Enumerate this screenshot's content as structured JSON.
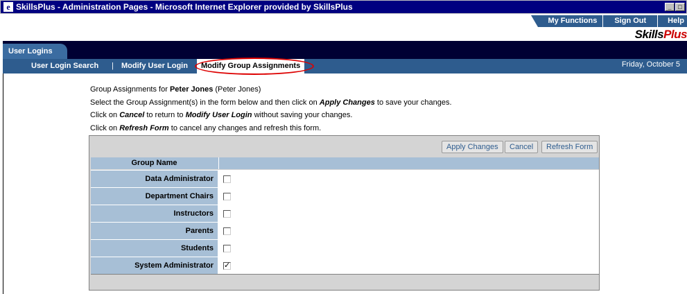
{
  "window": {
    "title": "SkillsPlus - Administration Pages - Microsoft Internet Explorer provided by SkillsPlus",
    "icon": "ie-icon",
    "min_label": "_",
    "max_label": "□"
  },
  "topnav": {
    "items": [
      "My Functions",
      "Sign Out",
      "Help"
    ]
  },
  "brand": {
    "name": "Skills",
    "suffix": "Plus"
  },
  "section_tab": "User Logins",
  "subnav": {
    "items": [
      "User Login Search",
      "Modify User Login",
      "Modify Group Assignments"
    ],
    "separator": "|",
    "active_index": 2,
    "date": "Friday, October 5"
  },
  "instructions": {
    "line1_prefix": "Group Assignments for ",
    "user_name": "Peter Jones",
    "user_paren": " (Peter Jones)",
    "line2_prefix": "Select the Group Assignment(s) in the form below and then click on ",
    "line2_action": "Apply Changes",
    "line2_suffix": " to save your changes.",
    "line3_prefix": "Click on ",
    "line3_action": "Cancel",
    "line3_middle": " to return to ",
    "line3_target": "Modify User Login",
    "line3_suffix": " without saving your changes.",
    "line4_prefix": "Click on ",
    "line4_action": "Refresh Form",
    "line4_suffix": " to cancel any changes and refresh this form."
  },
  "buttons": {
    "apply": "Apply Changes",
    "cancel": "Cancel",
    "refresh": "Refresh Form"
  },
  "table": {
    "header": "Group Name",
    "rows": [
      {
        "name": "Data Administrator",
        "checked": false
      },
      {
        "name": "Department Chairs",
        "checked": false
      },
      {
        "name": "Instructors",
        "checked": false
      },
      {
        "name": "Parents",
        "checked": false
      },
      {
        "name": "Students",
        "checked": false
      },
      {
        "name": "System Administrator",
        "checked": true
      }
    ]
  },
  "colors": {
    "accent": "#2e5c8e",
    "header_bg": "#a7bfd6",
    "highlight": "#dd0000",
    "dark_band": "#000033"
  }
}
